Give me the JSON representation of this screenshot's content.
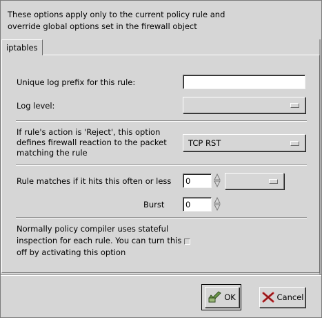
{
  "dialog": {
    "intro_text": "These options apply only to the current policy rule and override global options set in the firewall object",
    "tab_label": "iptables"
  },
  "form": {
    "log_prefix_label": "Unique log prefix for this rule:",
    "log_prefix_value": "",
    "log_level_label": "Log level:",
    "log_level_value": "",
    "reject_label": "If rule's action is 'Reject', this option defines firewall reaction to the packet matching the rule",
    "reject_value": "TCP RST",
    "limit_label": "Rule matches if it hits this often or less",
    "limit_value": "0",
    "limit_unit_value": "",
    "burst_label": "Burst",
    "burst_value": "0",
    "stateless_label": "Normally policy compiler uses stateful inspection for each rule. You can turn this off by activating this option",
    "stateless_checked": false
  },
  "buttons": {
    "ok_label": "OK",
    "ok_icon": "ok-checkmark-icon",
    "cancel_label": "Cancel",
    "cancel_icon": "cancel-x-icon"
  },
  "colors": {
    "window_bg": "#d6d6d6",
    "field_bg": "#ffffff",
    "cancel_icon_red": "#c0282a",
    "ok_icon_green": "#6d9a4a"
  }
}
